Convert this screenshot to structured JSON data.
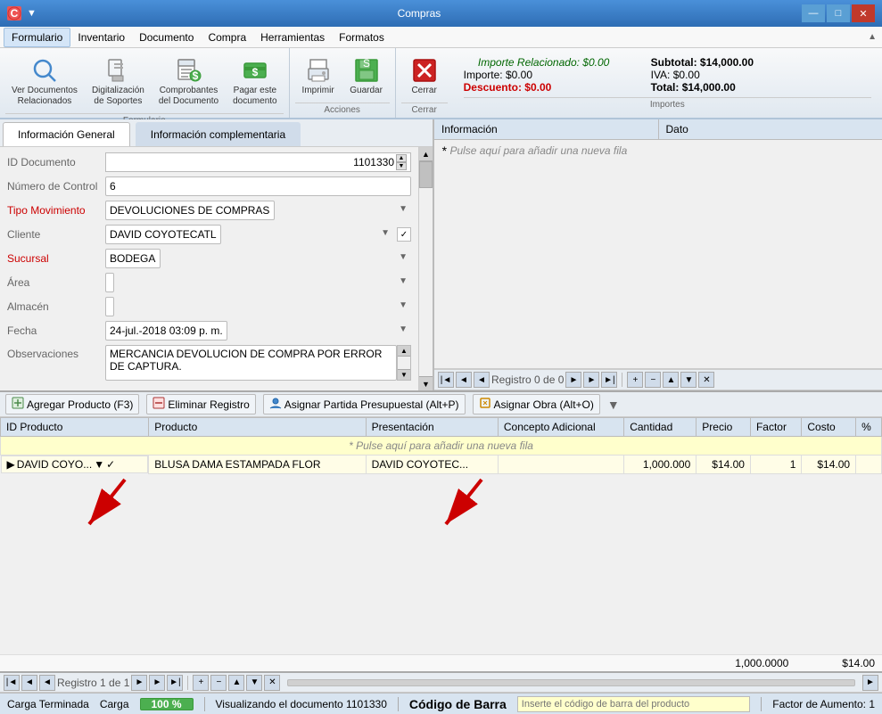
{
  "titlebar": {
    "title": "Compras",
    "minimize": "—",
    "maximize": "□",
    "close": "✕"
  },
  "menubar": {
    "items": [
      "Formulario",
      "Inventario",
      "Documento",
      "Compra",
      "Herramientas",
      "Formatos"
    ]
  },
  "ribbon": {
    "groups": [
      {
        "name": "Formulario",
        "buttons": [
          {
            "id": "ver-docs",
            "label": "Ver Documentos\nRelacionados",
            "icon": "🔍"
          },
          {
            "id": "digitalizar",
            "label": "Digitalización\nde Soportes",
            "icon": "📠"
          },
          {
            "id": "comprobantes",
            "label": "Comprobantes\ndel Documento",
            "icon": "📋"
          },
          {
            "id": "pagar",
            "label": "Pagar este\ndocumento",
            "icon": "💵"
          }
        ]
      },
      {
        "name": "Acciones",
        "buttons": [
          {
            "id": "imprimir",
            "label": "Imprimir",
            "icon": "🖨"
          },
          {
            "id": "guardar",
            "label": "Guardar",
            "icon": "💾"
          }
        ]
      },
      {
        "name": "Cerrar",
        "buttons": [
          {
            "id": "cerrar",
            "label": "Cerrar",
            "icon": "✕"
          }
        ]
      }
    ],
    "importes": {
      "related": "Importe Relacionado: $0.00",
      "importe_label": "Importe: $0.00",
      "descuento_label": "Descuento: $0.00",
      "subtotal_label": "Subtotal: $14,000.00",
      "iva_label": "IVA: $0.00",
      "total_label": "Total: $14,000.00",
      "section_name": "Importes"
    }
  },
  "tabs": {
    "left": [
      "Información General",
      "Información complementaria"
    ],
    "right": [
      "Información",
      "Dato"
    ]
  },
  "form": {
    "fields": [
      {
        "label": "ID Documento",
        "label_color": "normal",
        "value": "1101330",
        "type": "id"
      },
      {
        "label": "Número de Control",
        "label_color": "normal",
        "value": "6",
        "type": "text"
      },
      {
        "label": "Tipo Movimiento",
        "label_color": "red",
        "value": "DEVOLUCIONES DE COMPRAS",
        "type": "select"
      },
      {
        "label": "Cliente",
        "label_color": "normal",
        "value": "DAVID COYOTECATL",
        "type": "select-check"
      },
      {
        "label": "Sucursal",
        "label_color": "red",
        "value": "BODEGA",
        "type": "select"
      },
      {
        "label": "Área",
        "label_color": "normal",
        "value": "",
        "type": "select"
      },
      {
        "label": "Almacén",
        "label_color": "normal",
        "value": "",
        "type": "select"
      },
      {
        "label": "Fecha",
        "label_color": "normal",
        "value": "24-jul.-2018 03:09 p. m.",
        "type": "select"
      },
      {
        "label": "Observaciones",
        "label_color": "normal",
        "value": "MERCANCIA DEVOLUCION DE COMPRA POR ERROR DE CAPTURA.",
        "type": "textarea"
      }
    ]
  },
  "info_panel": {
    "add_row_text": "Pulse aquí para añadir una nueva fila"
  },
  "nav_bar": {
    "record_text": "Registro 0 de 0"
  },
  "grid_toolbar": {
    "buttons": [
      {
        "label": "Agregar Producto (F3)",
        "icon": "➕"
      },
      {
        "label": "Eliminar Registro",
        "icon": "🗑"
      },
      {
        "label": "Asignar Partida Presupuestal (Alt+P)",
        "icon": "👤"
      },
      {
        "label": "Asignar Obra (Alt+O)",
        "icon": "📎"
      }
    ]
  },
  "grid": {
    "columns": [
      "ID Producto",
      "Producto",
      "Presentación",
      "Concepto Adicional",
      "Cantidad",
      "Precio",
      "Factor",
      "Costo",
      "%"
    ],
    "add_row_text": "Pulse aquí para añadir una nueva fila",
    "rows": [
      {
        "id_producto": "DAVID COYO...",
        "producto": "BLUSA DAMA ESTAMPADA FLOR",
        "presentacion": "DAVID COYOTEC...",
        "concepto_adicional": "",
        "cantidad": "1,000.000",
        "precio": "$14.00",
        "factor": "1",
        "costo": "$14.00",
        "percent": ""
      }
    ]
  },
  "bottom_nav": {
    "record_text": "Registro 1 de 1",
    "total_qty": "1,000.0000",
    "total_cost": "$14.00"
  },
  "status_bar": {
    "carga_terminada": "Carga Terminada",
    "carga": "Carga",
    "progress": "100 %",
    "visualizando": "Visualizando el documento 1101330",
    "codigo_barra": "Código de Barra",
    "barcode_placeholder": "Inserte el código de barra del producto",
    "factor": "Factor de Aumento: 1"
  }
}
